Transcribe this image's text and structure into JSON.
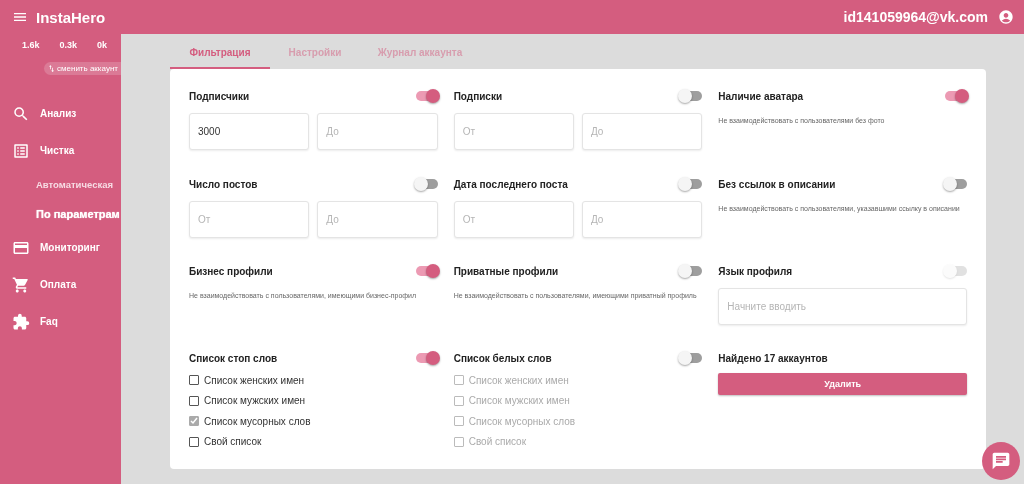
{
  "header": {
    "app_name": "InstaHero",
    "account": "id141059964@vk.com"
  },
  "sidebar": {
    "stats": [
      "1.6k",
      "0.3k",
      "0k"
    ],
    "switch_account": "сменить аккаунт",
    "items": [
      {
        "label": "Анализ"
      },
      {
        "label": "Чистка",
        "children": [
          {
            "label": "Автоматическая",
            "selected": false
          },
          {
            "label": "По параметрам",
            "selected": true
          }
        ]
      },
      {
        "label": "Мониторинг"
      },
      {
        "label": "Оплата"
      },
      {
        "label": "Faq"
      }
    ]
  },
  "tabs": [
    {
      "label": "Фильтрация",
      "selected": true
    },
    {
      "label": "Настройки",
      "selected": false
    },
    {
      "label": "Журнал аккаунта",
      "selected": false
    }
  ],
  "filters": [
    {
      "kind": "range",
      "title": "Подписчики",
      "toggle": {
        "on": true,
        "disabled": false
      },
      "from": {
        "value": "3000"
      },
      "to": {
        "placeholder": "До"
      }
    },
    {
      "kind": "range",
      "title": "Подписки",
      "toggle": {
        "on": false,
        "disabled": false
      },
      "from": {
        "placeholder": "От"
      },
      "to": {
        "placeholder": "До"
      }
    },
    {
      "kind": "note",
      "title": "Наличие аватара",
      "toggle": {
        "on": true,
        "disabled": false
      },
      "note": "Не взаимодействовать с пользователями без фото"
    },
    {
      "kind": "range",
      "title": "Число постов",
      "toggle": {
        "on": false,
        "disabled": false
      },
      "from": {
        "placeholder": "От"
      },
      "to": {
        "placeholder": "До"
      }
    },
    {
      "kind": "range",
      "title": "Дата последнего поста",
      "toggle": {
        "on": false,
        "disabled": false
      },
      "from": {
        "placeholder": "От"
      },
      "to": {
        "placeholder": "До"
      }
    },
    {
      "kind": "note",
      "title": "Без ссылок в описании",
      "toggle": {
        "on": false,
        "disabled": false
      },
      "note": "Не взаимодействовать с пользователями, указавшими ссылку в описании"
    },
    {
      "kind": "note",
      "title": "Бизнес профили",
      "toggle": {
        "on": true,
        "disabled": false
      },
      "note": "Не взаимодействовать с пользователями, имеющими бизнес-профил"
    },
    {
      "kind": "note",
      "title": "Приватные профили",
      "toggle": {
        "on": false,
        "disabled": false
      },
      "note": "Не взаимодействовать с пользователями, имеющими приватный профиль"
    },
    {
      "kind": "text",
      "title": "Язык профиля",
      "toggle": {
        "on": false,
        "disabled": true
      },
      "field": {
        "placeholder": "Начните вводить"
      }
    },
    {
      "kind": "checklist",
      "title": "Список стоп слов",
      "toggle": {
        "on": true,
        "disabled": false
      },
      "items": [
        {
          "label": "Список женских имен",
          "checked": false,
          "disabled": false
        },
        {
          "label": "Список мужских имен",
          "checked": false,
          "disabled": false
        },
        {
          "label": "Список мусорных слов",
          "checked": true,
          "disabled": false
        },
        {
          "label": "Свой список",
          "checked": false,
          "disabled": false
        }
      ]
    },
    {
      "kind": "checklist",
      "title": "Список белых слов",
      "toggle": {
        "on": false,
        "disabled": false
      },
      "items": [
        {
          "label": "Список женских имен",
          "checked": false,
          "disabled": true
        },
        {
          "label": "Список мужских имен",
          "checked": false,
          "disabled": true
        },
        {
          "label": "Список мусорных слов",
          "checked": false,
          "disabled": true
        },
        {
          "label": "Свой список",
          "checked": false,
          "disabled": true
        }
      ]
    },
    {
      "kind": "action",
      "title": "Найдено 17 аккаунтов",
      "button": "Удалить"
    }
  ]
}
